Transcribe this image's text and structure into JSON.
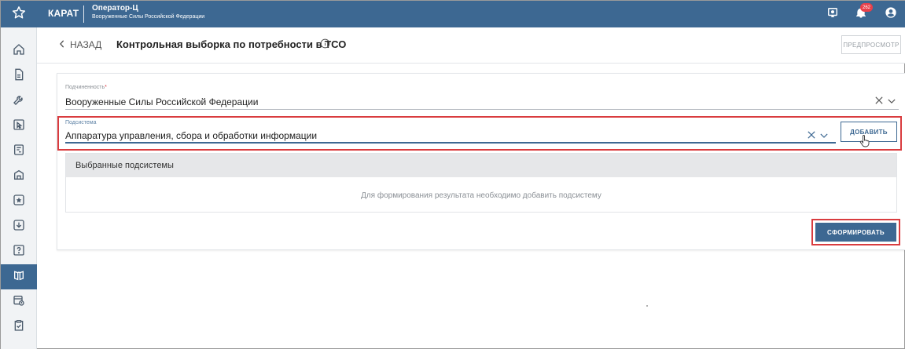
{
  "topbar": {
    "brand": "КАРАТ",
    "operator_name": "Оператор-Ц",
    "operator_org": "Вооруженные Силы Российской Федерации",
    "notification_count": "262",
    "colors": {
      "bar": "#3d6892",
      "badge": "#e8404a"
    },
    "icons": [
      "star-icon",
      "monitor-icon",
      "bell-icon",
      "user-account-icon"
    ]
  },
  "sidebar": {
    "items": [
      {
        "icon": "home-icon"
      },
      {
        "icon": "document-icon"
      },
      {
        "icon": "wrench-icon"
      },
      {
        "icon": "cursor-box-icon"
      },
      {
        "icon": "report-icon"
      },
      {
        "icon": "building-icon"
      },
      {
        "icon": "star-box-icon"
      },
      {
        "icon": "download-box-icon"
      },
      {
        "icon": "help-box-icon"
      },
      {
        "icon": "book-icon",
        "active": true
      },
      {
        "icon": "calendar-clock-icon"
      },
      {
        "icon": "clipboard-check-icon"
      }
    ]
  },
  "header": {
    "back_label": "НАЗАД",
    "title": "Контрольная выборка по потребности в ТСО",
    "preview_label": "ПРЕДПРОСМОТР"
  },
  "form": {
    "subordination": {
      "label": "Подчиненность",
      "required_mark": "*",
      "value": "Вооруженные Силы Российской Федерации"
    },
    "subsystem": {
      "label": "Подсистема",
      "value": "Аппаратура управления, сбора и обработки информации"
    },
    "add_label": "ДОБАВИТЬ",
    "selected_title": "Выбранные подсистемы",
    "empty_message": "Для формирования результата необходимо добавить подсистему",
    "submit_label": "СФОРМИРОВАТЬ",
    "highlight_color": "#d93c3f"
  }
}
